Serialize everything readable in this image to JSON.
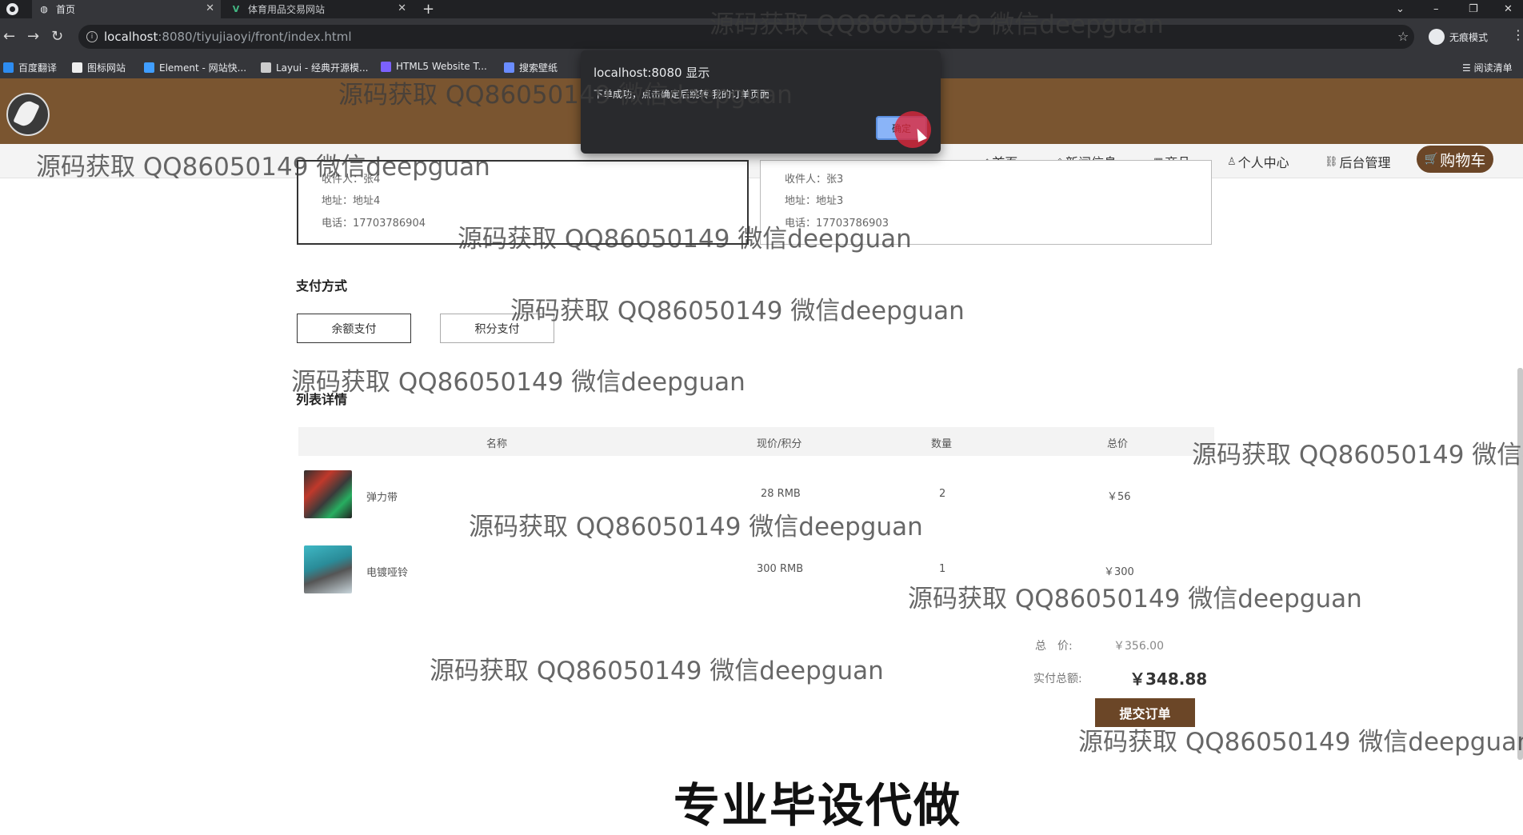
{
  "browser": {
    "tabs": [
      {
        "title": "首页",
        "active": true
      },
      {
        "title": "体育用品交易网站",
        "active": false
      }
    ],
    "url_host": "localhost",
    "url_rest": ":8080/tiyujiaoyi/front/index.html",
    "profile_label": "无痕模式",
    "bookmarks": [
      "百度翻译",
      "图标网站",
      "Element - 网站快...",
      "Layui - 经典开源模...",
      "HTML5 Website T...",
      "搜索壁纸"
    ],
    "reading_list": "阅读清单"
  },
  "dialog": {
    "title": "localhost:8080 显示",
    "message": "下单成功，点击确定后跳转 我的订单页面",
    "ok_label": "确定"
  },
  "nav": {
    "items": [
      {
        "label": "首页",
        "icon": "home-icon"
      },
      {
        "label": "新闻信息",
        "icon": "tag-icon"
      },
      {
        "label": "商品",
        "icon": "grid-icon"
      },
      {
        "label": "个人中心",
        "icon": "user-icon"
      },
      {
        "label": "后台管理",
        "icon": "link-icon"
      }
    ],
    "cart_label": "购物车"
  },
  "addresses": [
    {
      "receiver": "收件人：张4",
      "address": "地址：地址4",
      "phone": "电话：17703786904",
      "selected": true
    },
    {
      "receiver": "收件人：张3",
      "address": "地址：地址3",
      "phone": "电话：17703786903",
      "selected": false
    }
  ],
  "payment": {
    "title": "支付方式",
    "options": [
      "余额支付",
      "积分支付"
    ],
    "selected": "余额支付"
  },
  "order_list": {
    "title": "列表详情",
    "columns": [
      "名称",
      "现价/积分",
      "数量",
      "总价"
    ],
    "rows": [
      {
        "name": "弹力带",
        "price": "28 RMB",
        "qty": "2",
        "total": "￥56"
      },
      {
        "name": "电镀哑铃",
        "price": "300 RMB",
        "qty": "1",
        "total": "￥300"
      }
    ]
  },
  "summary": {
    "total_label": "总　价:",
    "total_value": "￥356.00",
    "paid_label": "实付总额:",
    "paid_value": "￥348.88",
    "submit_label": "提交订单"
  },
  "watermark_text": "源码获取 QQ86050149 微信deepguan",
  "caption": "专业毕设代做",
  "colors": {
    "brand_brown": "#7a5530",
    "button_brown": "#6b4627",
    "dialog_bg": "#292a2d"
  }
}
